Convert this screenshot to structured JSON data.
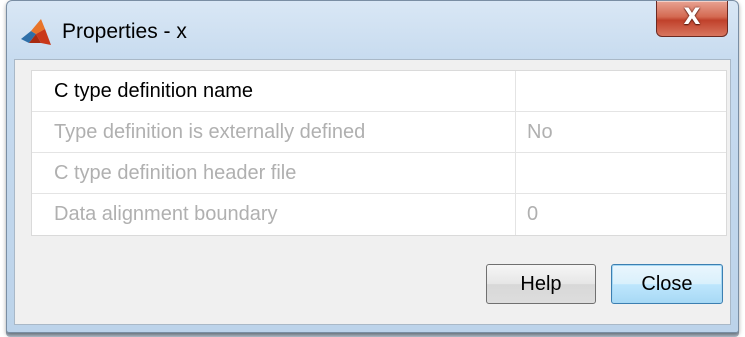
{
  "window": {
    "title": "Properties - x",
    "app_icon": "matlab-membrane-icon",
    "close_icon": "close-icon",
    "close_glyph": "X"
  },
  "properties": [
    {
      "name": "C type definition name",
      "value": "",
      "enabled": true
    },
    {
      "name": "Type definition is externally defined",
      "value": "No",
      "enabled": false
    },
    {
      "name": "C type definition header file",
      "value": "",
      "enabled": false
    },
    {
      "name": "Data alignment boundary",
      "value": "0",
      "enabled": false
    }
  ],
  "buttons": {
    "help_label": "Help",
    "close_label": "Close"
  },
  "colors": {
    "close_button_red": "#c0412b",
    "default_button_blue": "#3c7fb1",
    "disabled_text": "#b0b0b0"
  }
}
